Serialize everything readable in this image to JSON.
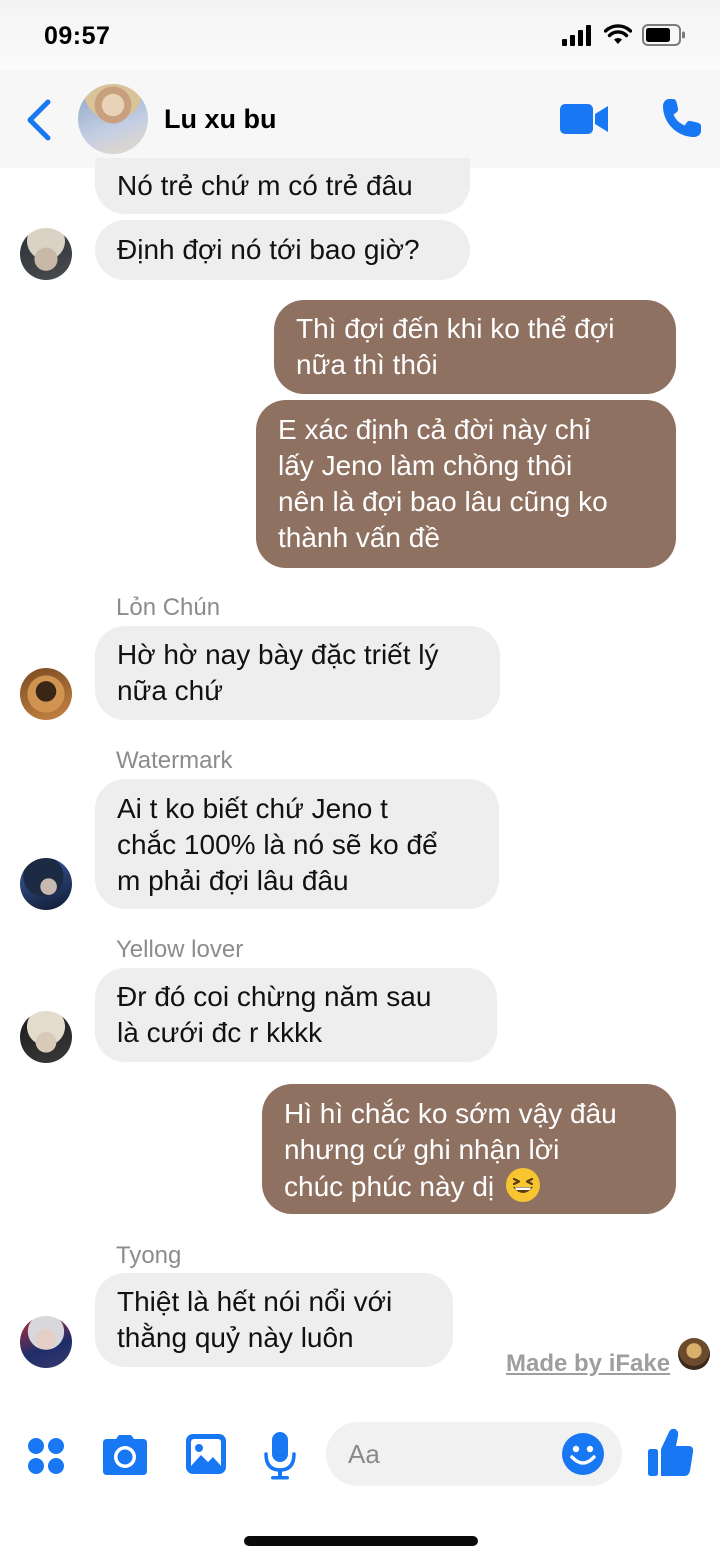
{
  "status_bar": {
    "time": "09:57",
    "icons": [
      "signal-icon",
      "wifi-icon",
      "battery-icon"
    ]
  },
  "header": {
    "title": "Lu xu bu",
    "icons": [
      "back-chevron-icon",
      "video-call-icon",
      "phone-icon"
    ],
    "accent_color": "#1877f2"
  },
  "messages": [
    {
      "direction": "incoming",
      "sender": "",
      "lines": [
        "Nó trẻ chứ m có trẻ đâu"
      ]
    },
    {
      "direction": "incoming",
      "sender": "",
      "lines": [
        "Định đợi nó tới bao giờ?"
      ]
    },
    {
      "direction": "outgoing",
      "lines": [
        "Thì đợi đến khi ko thể đợi",
        "nữa thì thôi"
      ]
    },
    {
      "direction": "outgoing",
      "lines": [
        "E xác định cả đời này chỉ",
        "lấy Jeno làm chồng thôi",
        "nên là đợi bao lâu cũng ko",
        "thành vấn đề"
      ]
    },
    {
      "direction": "incoming",
      "sender": "Lỏn Chún",
      "lines": [
        "Hờ hờ nay bày đặc triết lý",
        "nữa chứ"
      ]
    },
    {
      "direction": "incoming",
      "sender": "Watermark",
      "lines": [
        "Ai t ko biết chứ Jeno t",
        "chắc 100% là nó sẽ ko để",
        "m phải đợi lâu đâu"
      ]
    },
    {
      "direction": "incoming",
      "sender": "Yellow lover",
      "lines": [
        "Đr đó coi chừng năm sau",
        "là cưới đc r kkkk"
      ]
    },
    {
      "direction": "outgoing",
      "lines": [
        "Hì hì chắc ko sớm vậy đâu",
        "nhưng cứ ghi nhận lời",
        "chúc phúc này dị"
      ],
      "trailing_emoji": "grinning-squinting-face-emoji"
    },
    {
      "direction": "incoming",
      "sender": "Tyong",
      "lines": [
        "Thiệt là hết nói nổi với",
        "thằng quỷ này luôn"
      ]
    }
  ],
  "watermark": "Made by iFake",
  "composer": {
    "placeholder": "Aa",
    "icons": [
      "apps-grid-icon",
      "camera-icon",
      "gallery-icon",
      "microphone-icon",
      "emoji-icon",
      "thumbs-up-icon"
    ]
  },
  "colors": {
    "outgoing_bubble": "#8f7162",
    "incoming_bubble": "#eeeeee",
    "accent": "#1877f2"
  }
}
